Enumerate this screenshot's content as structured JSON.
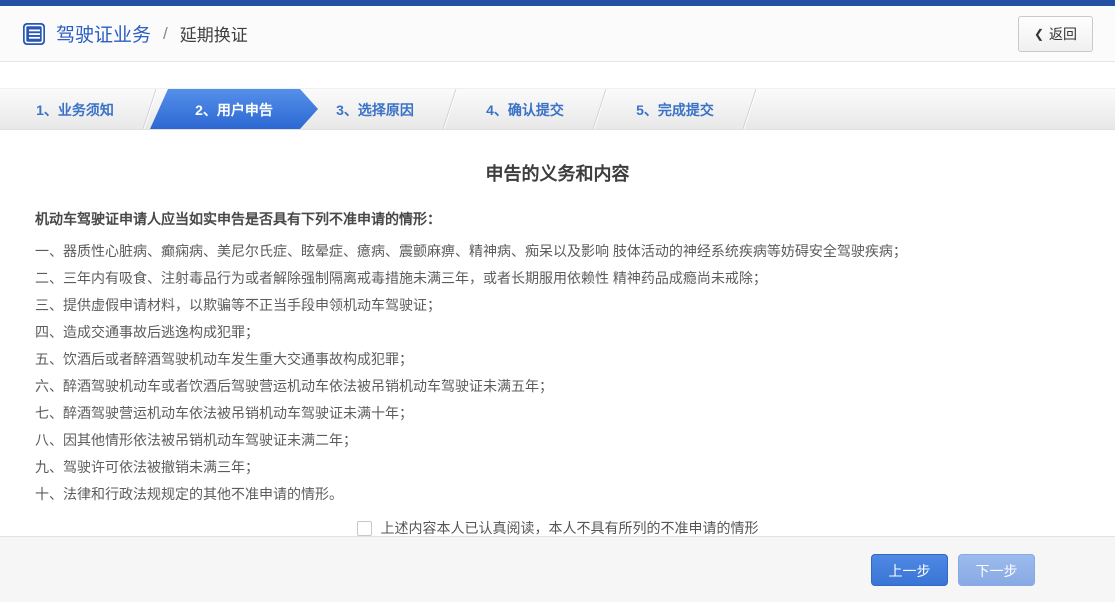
{
  "header": {
    "title": "驾驶证业务",
    "separator": "/",
    "subtitle": "延期换证",
    "back_chevron": "❮",
    "back_label": "返回"
  },
  "steps": [
    {
      "label": "1、业务须知",
      "active": false
    },
    {
      "label": "2、用户申告",
      "active": true
    },
    {
      "label": "3、选择原因",
      "active": false
    },
    {
      "label": "4、确认提交",
      "active": false
    },
    {
      "label": "5、完成提交",
      "active": false
    }
  ],
  "content": {
    "title": "申告的义务和内容",
    "intro": "机动车驾驶证申请人应当如实申告是否具有下列不准申请的情形：",
    "items": [
      "一、器质性心脏病、癫痫病、美尼尔氏症、眩晕症、癔病、震颤麻痹、精神病、痴呆以及影响 肢体活动的神经系统疾病等妨碍安全驾驶疾病；",
      "二、三年内有吸食、注射毒品行为或者解除强制隔离戒毒措施未满三年，或者长期服用依赖性 精神药品成瘾尚未戒除；",
      "三、提供虚假申请材料，以欺骗等不正当手段申领机动车驾驶证；",
      "四、造成交通事故后逃逸构成犯罪；",
      "五、饮酒后或者醉酒驾驶机动车发生重大交通事故构成犯罪；",
      "六、醉酒驾驶机动车或者饮酒后驾驶营运机动车依法被吊销机动车驾驶证未满五年；",
      "七、醉酒驾驶营运机动车依法被吊销机动车驾驶证未满十年；",
      "八、因其他情形依法被吊销机动车驾驶证未满二年；",
      "九、驾驶许可依法被撤销未满三年；",
      "十、法律和行政法规规定的其他不准申请的情形。"
    ],
    "checkbox_checked": false,
    "agree_label": "上述内容本人已认真阅读，本人不具有所列的不准申请的情形"
  },
  "footer": {
    "prev_label": "上一步",
    "next_label": "下一步"
  },
  "colors": {
    "top_bar": "#2350a5",
    "link_blue": "#3a72c8",
    "active_step": "#3b78dd",
    "button_primary": "#3e7ce0",
    "button_disabled": "#92b2e9"
  }
}
